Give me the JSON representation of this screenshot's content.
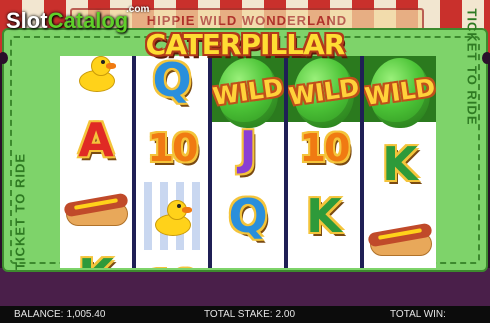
{
  "watermark": {
    "prefix": "Slot",
    "brand": "Catalog",
    "suffix": ".com"
  },
  "game": {
    "logo": "CATERPILLAR",
    "background_banner": "HIPPIE WILD WONDERLAND"
  },
  "ticket": {
    "side_text_left": "TICKET TO RIDE",
    "side_text_right": "TICKET TO RIDE"
  },
  "reels": {
    "reel1": {
      "row1": "duck",
      "row2": "A",
      "row3": "hotdog",
      "row4": "K"
    },
    "reel2": {
      "row1": "Q",
      "row2": "10",
      "row3": "duck",
      "row4": "10"
    },
    "reel3": {
      "wild_label": "WILD",
      "row3": "Q"
    },
    "reel4": {
      "wild_label": "WILD",
      "row2": "10",
      "row3": "K"
    },
    "reel5": {
      "wild_label": "WILD",
      "row2": "K",
      "row3": "hotdog"
    }
  },
  "bottom_bar": {
    "balance_label": "BALANCE:",
    "balance_value": "1,005.40",
    "stake_label": "TOTAL STAKE:",
    "stake_value": "2.00",
    "win_label": "TOTAL WIN:",
    "win_value": ""
  },
  "colors": {
    "ticket_green": "#7ed36a",
    "wild_reel": "#2b7a1e",
    "reel_bg": "#1f1f55"
  }
}
